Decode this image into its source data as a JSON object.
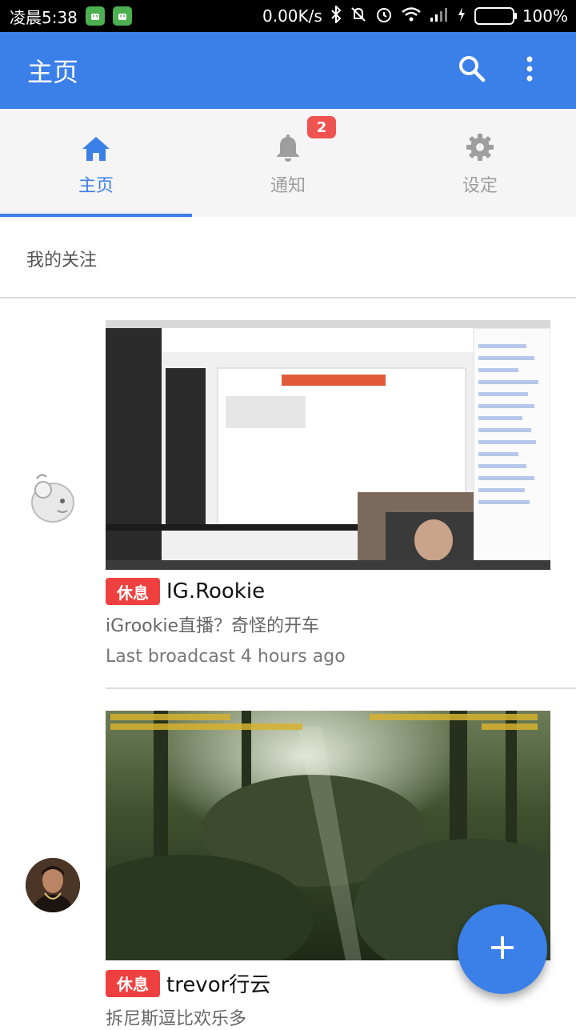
{
  "statusbar": {
    "time": "凌晨5:38",
    "net_speed": "0.00K/s",
    "battery": "100%"
  },
  "appbar": {
    "title": "主页",
    "icons": [
      "search-icon",
      "more-vert-icon"
    ]
  },
  "tabs": [
    {
      "label": "主页",
      "icon": "home-icon",
      "active": true
    },
    {
      "label": "通知",
      "icon": "bell-icon",
      "badge": "2"
    },
    {
      "label": "设定",
      "icon": "gear-icon"
    }
  ],
  "section": {
    "title": "我的关注"
  },
  "follows": [
    {
      "status": "休息",
      "name": "IG.Rookie",
      "title": "iGrookie直播？奇怪的开车",
      "last_broadcast": "Last broadcast 4 hours ago"
    },
    {
      "status": "休息",
      "name": "trevor行云",
      "title": "拆尼斯逗比欢乐多"
    }
  ],
  "colors": {
    "accent": "#3b7fe9",
    "status_badge": "#ef4040",
    "notification_badge": "#ef5350"
  }
}
